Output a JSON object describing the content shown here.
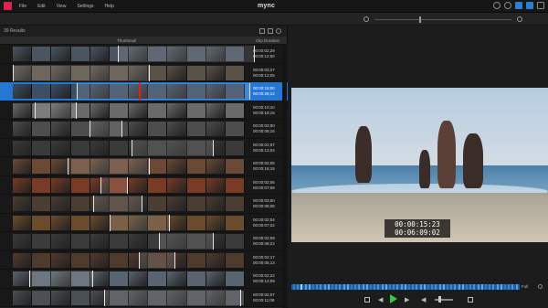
{
  "menu": {
    "items": [
      "File",
      "Edit",
      "View",
      "Settings",
      "Help"
    ]
  },
  "window": {
    "title": "mync"
  },
  "results": {
    "count_label": "39 Results"
  },
  "columns": {
    "thumbnail": "Thumbnail",
    "duration": "Clip Duration"
  },
  "rows": [
    {
      "tc_in": "00:00:02;29",
      "tc_out": "00:00:12;00",
      "selected": false
    },
    {
      "tc_in": "00:00:03;27",
      "tc_out": "00:00:12;05",
      "selected": false
    },
    {
      "tc_in": "00:00:15;00",
      "tc_out": "00:00:29;12",
      "selected": true
    },
    {
      "tc_in": "00:00:10;10",
      "tc_out": "00:00:19;16",
      "selected": false
    },
    {
      "tc_in": "00:00:03;00",
      "tc_out": "00:00:09;16",
      "selected": false
    },
    {
      "tc_in": "00:00:02;07",
      "tc_out": "00:00:13;04",
      "selected": false
    },
    {
      "tc_in": "00:00:02;05",
      "tc_out": "00:00:16;15",
      "selected": false
    },
    {
      "tc_in": "00:00:02;06",
      "tc_out": "00:00:07;08",
      "selected": false
    },
    {
      "tc_in": "00:00:03;00",
      "tc_out": "00:00:08;08",
      "selected": false
    },
    {
      "tc_in": "00:00:02;04",
      "tc_out": "00:00:07;22",
      "selected": false
    },
    {
      "tc_in": "00:00:02;09",
      "tc_out": "00:00:08;22",
      "selected": false
    },
    {
      "tc_in": "00:00:02;17",
      "tc_out": "00:00:06;13",
      "selected": false
    },
    {
      "tc_in": "00:00:02;22",
      "tc_out": "00:00:14;09",
      "selected": false
    },
    {
      "tc_in": "00:00:02;07",
      "tc_out": "00:00:11;08",
      "selected": false
    }
  ],
  "viewer": {
    "timecode_current": "00:00:15:23",
    "timecode_duration": "00:06:09:02"
  },
  "transport": {
    "zoom_label": "Full"
  },
  "colors": {
    "accent": "#2577d6",
    "brand": "#e0224e",
    "play": "#2ecc40",
    "playhead": "#e02020"
  },
  "icons": [
    "app-logo-icon",
    "search-icon",
    "gear-icon",
    "layout-icon",
    "undo-icon",
    "export-icon",
    "settings-icon",
    "play-icon",
    "step-back-icon",
    "step-forward-icon",
    "volume-icon",
    "fullscreen-icon"
  ]
}
